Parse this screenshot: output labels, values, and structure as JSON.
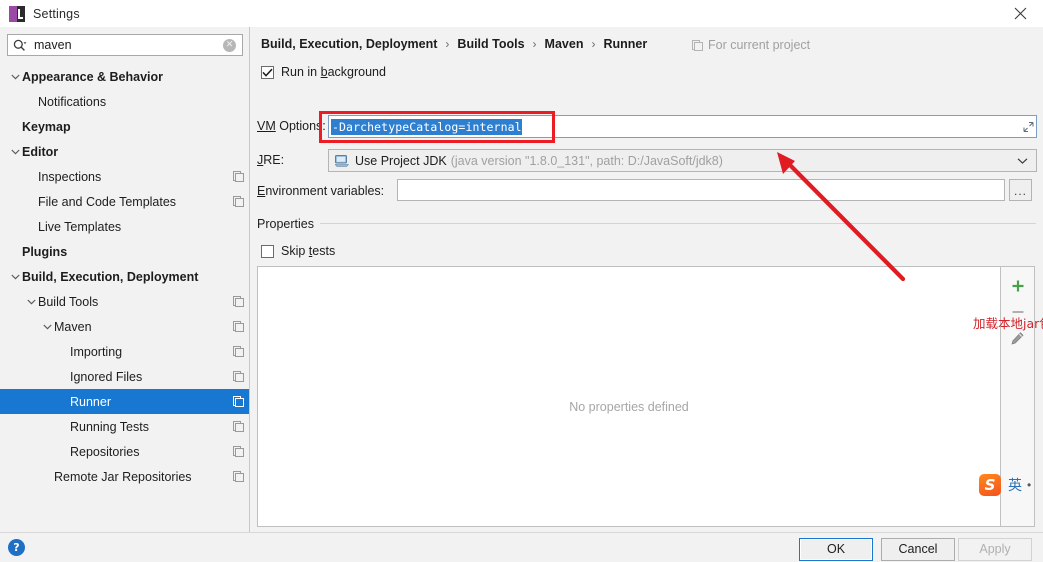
{
  "window": {
    "title": "Settings",
    "app_icon": "intellij-idea-icon",
    "close_icon": "close-icon"
  },
  "sidebar": {
    "search": {
      "value": "maven",
      "placeholder": "Search settings",
      "icon": "search-icon",
      "clear_icon": "clear-icon"
    },
    "items": [
      {
        "label": "Appearance & Behavior",
        "indent": 0,
        "bold": true,
        "arrow": "expanded",
        "project_icon": false,
        "selected": false
      },
      {
        "label": "Notifications",
        "indent": 1,
        "bold": false,
        "arrow": "none",
        "project_icon": false,
        "selected": false
      },
      {
        "label": "Keymap",
        "indent": 0,
        "bold": true,
        "arrow": "none",
        "project_icon": false,
        "selected": false
      },
      {
        "label": "Editor",
        "indent": 0,
        "bold": true,
        "arrow": "expanded",
        "project_icon": false,
        "selected": false
      },
      {
        "label": "Inspections",
        "indent": 1,
        "bold": false,
        "arrow": "none",
        "project_icon": true,
        "selected": false
      },
      {
        "label": "File and Code Templates",
        "indent": 1,
        "bold": false,
        "arrow": "none",
        "project_icon": true,
        "selected": false
      },
      {
        "label": "Live Templates",
        "indent": 1,
        "bold": false,
        "arrow": "none",
        "project_icon": false,
        "selected": false
      },
      {
        "label": "Plugins",
        "indent": 0,
        "bold": true,
        "arrow": "none",
        "project_icon": false,
        "selected": false
      },
      {
        "label": "Build, Execution, Deployment",
        "indent": 0,
        "bold": true,
        "arrow": "expanded",
        "project_icon": false,
        "selected": false
      },
      {
        "label": "Build Tools",
        "indent": 1,
        "bold": false,
        "arrow": "expanded",
        "project_icon": true,
        "selected": false
      },
      {
        "label": "Maven",
        "indent": 2,
        "bold": false,
        "arrow": "expanded",
        "project_icon": true,
        "selected": false
      },
      {
        "label": "Importing",
        "indent": 3,
        "bold": false,
        "arrow": "none",
        "project_icon": true,
        "selected": false
      },
      {
        "label": "Ignored Files",
        "indent": 3,
        "bold": false,
        "arrow": "none",
        "project_icon": true,
        "selected": false
      },
      {
        "label": "Runner",
        "indent": 3,
        "bold": false,
        "arrow": "none",
        "project_icon": true,
        "selected": true
      },
      {
        "label": "Running Tests",
        "indent": 3,
        "bold": false,
        "arrow": "none",
        "project_icon": true,
        "selected": false
      },
      {
        "label": "Repositories",
        "indent": 3,
        "bold": false,
        "arrow": "none",
        "project_icon": true,
        "selected": false
      },
      {
        "label": "Remote Jar Repositories",
        "indent": 2,
        "bold": false,
        "arrow": "none",
        "project_icon": true,
        "selected": false
      }
    ]
  },
  "content": {
    "breadcrumb": [
      "Build, Execution, Deployment",
      "Build Tools",
      "Maven",
      "Runner"
    ],
    "breadcrumb_separator": "›",
    "for_current_project": "For current project",
    "for_current_project_icon": "project-scope-icon",
    "run_in_background": {
      "label_pre": "Run in ",
      "label_mnemonic": "b",
      "label_post": "ackground",
      "checked": true
    },
    "vm_options": {
      "label_mnemonic": "VM",
      "label_rest": " Options:",
      "value": "-DarchetypeCatalog=internal",
      "selected": true,
      "expand_icon": "expand-editor-icon",
      "highlight_color": "#ec1c24",
      "selection_color": "#2f7fd1"
    },
    "jre": {
      "label_mnemonic": "J",
      "label_rest": "RE:",
      "icon": "jdk-icon",
      "value": "Use Project JDK",
      "detail": "(java version \"1.8.0_131\", path: D:/JavaSoft/jdk8)",
      "caret_icon": "chevron-down-icon"
    },
    "environment_variables": {
      "label_mnemonic": "E",
      "label_rest": "nvironment variables:",
      "value": "",
      "browse_label": "..."
    },
    "properties": {
      "section_title": "Properties",
      "skip_tests": {
        "label_pre": "Skip ",
        "label_mnemonic": "t",
        "label_post": "ests",
        "checked": false
      },
      "empty_text": "No properties defined",
      "toolbar": [
        {
          "name": "add-property-button",
          "icon": "plus-icon",
          "color": "#4a9f4a"
        },
        {
          "name": "remove-property-button",
          "icon": "minus-icon",
          "color": "#b0b0b0"
        },
        {
          "name": "edit-property-button",
          "icon": "pencil-icon",
          "color": "#8a8a8a"
        }
      ]
    },
    "annotation": {
      "text": "加载本地jar包配置",
      "color": "#d2232a",
      "arrow_color": "#e01b22"
    }
  },
  "footer": {
    "help_icon": "help-icon",
    "help_label": "?",
    "buttons": [
      {
        "label": "OK",
        "name": "ok-button",
        "state": "default"
      },
      {
        "label": "Cancel",
        "name": "cancel-button",
        "state": "normal"
      },
      {
        "label": "Apply",
        "name": "apply-button",
        "state": "disabled"
      }
    ]
  },
  "ime": {
    "logo_letter": "S",
    "mode": "英",
    "dot": "•"
  }
}
